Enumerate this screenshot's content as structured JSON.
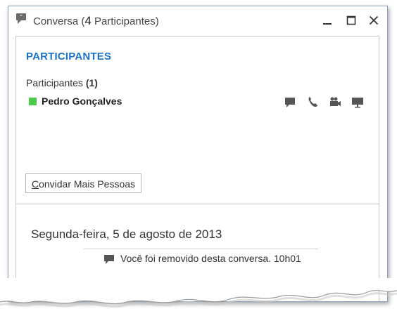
{
  "window": {
    "title_prefix": "Conversa (",
    "title_count": "4",
    "title_suffix": " Participantes)"
  },
  "participants": {
    "header": "PARTICIPANTES",
    "count_label": "Participantes ",
    "count_value": "(1)",
    "list": [
      {
        "name": "Pedro Gonçalves",
        "presence_color": "#4cc84a"
      }
    ],
    "actions": [
      "im-icon",
      "phone-icon",
      "video-icon",
      "screen-share-icon"
    ]
  },
  "invite": {
    "accesskey_letter": "C",
    "label_rest": "onvidar Mais Pessoas"
  },
  "conversation": {
    "date": "Segunda-feira, 5 de agosto de 2013",
    "messages": [
      {
        "text": "Você foi removido desta conversa. 10h01",
        "icon": "message-bubble-icon"
      }
    ]
  },
  "colors": {
    "accent": "#1a73c6",
    "presence_available": "#4cc84a",
    "window_border": "#8aa4bf"
  }
}
